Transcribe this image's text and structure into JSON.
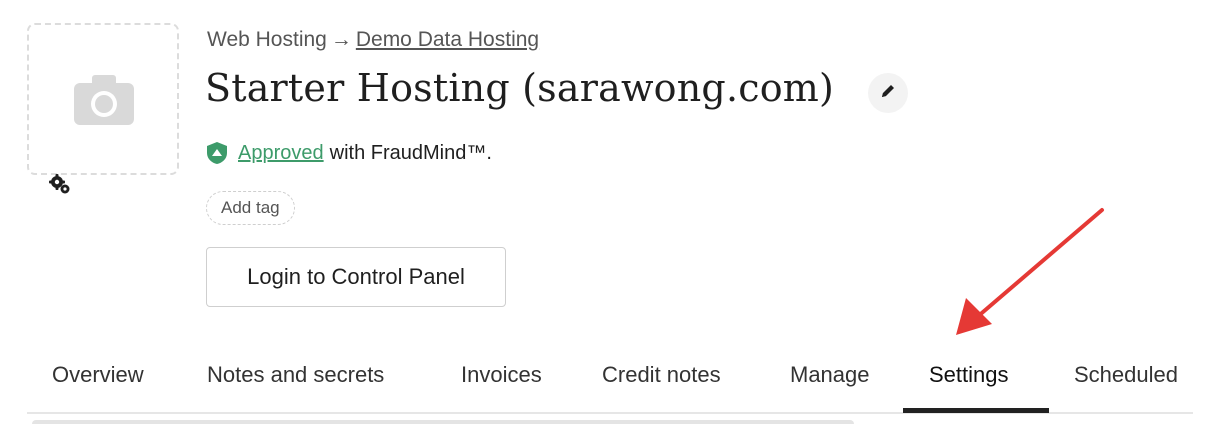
{
  "breadcrumb": {
    "parent": "Web Hosting",
    "separator": "→",
    "current": "Demo Data Hosting"
  },
  "title": "Starter Hosting (sarawong.com)",
  "fraud": {
    "status": "Approved",
    "suffix": "with FraudMind™."
  },
  "tag": {
    "add_label": "Add tag"
  },
  "actions": {
    "control_panel_label": "Login to Control Panel"
  },
  "tabs": [
    {
      "label": "Overview",
      "active": false
    },
    {
      "label": "Notes and secrets",
      "active": false
    },
    {
      "label": "Invoices",
      "active": false
    },
    {
      "label": "Credit notes",
      "active": false
    },
    {
      "label": "Manage",
      "active": false
    },
    {
      "label": "Settings",
      "active": true
    },
    {
      "label": "Scheduled",
      "active": false
    }
  ],
  "icons": {
    "image_placeholder": "camera-icon",
    "image_settings": "gears-icon",
    "edit_title": "pencil-icon",
    "fraud_status": "shield-icon"
  },
  "colors": {
    "approved": "#3d9b6a",
    "annotation_arrow": "#e53935",
    "active_tab_underline": "#222222"
  }
}
